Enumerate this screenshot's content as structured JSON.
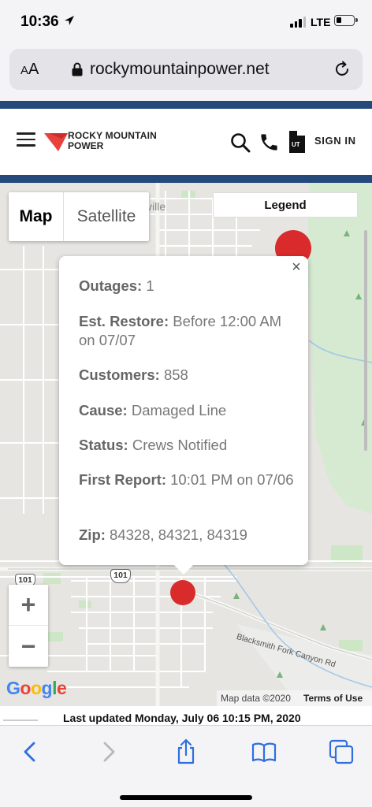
{
  "status_bar": {
    "time": "10:36",
    "network": "LTE",
    "icons": [
      "location-arrow-icon",
      "signal-icon",
      "battery-icon"
    ]
  },
  "browser": {
    "text_size_label_big": "A",
    "text_size_label_small": "A",
    "url": "rockymountainpower.net",
    "icons": [
      "lock-icon",
      "reload-icon"
    ]
  },
  "site_header": {
    "logo_line1": "ROCKY MOUNTAIN",
    "logo_line2": "POWER",
    "state_label": "UT",
    "sign_in_label": "SIGN IN",
    "icons": [
      "menu-icon",
      "search-icon",
      "phone-icon",
      "utah-state-icon"
    ],
    "brand_color": "#24497a",
    "logo_accent": "#e8423d"
  },
  "map": {
    "map_button": "Map",
    "satellite_button": "Satellite",
    "legend_button": "Legend",
    "village_label": "ville",
    "road_label": "Blacksmith Fork Canyon Rd",
    "shields": [
      "101",
      "101"
    ],
    "attribution": "Map data ©2020",
    "terms": "Terms of Use",
    "google_letters": [
      "G",
      "o",
      "o",
      "g",
      "l",
      "e"
    ],
    "google_colors": [
      "#4285f4",
      "#ea4335",
      "#fbbc05",
      "#4285f4",
      "#34a853",
      "#ea4335"
    ],
    "marker_color": "#d92b2b",
    "zoom_in_label": "+",
    "zoom_out_label": "−"
  },
  "outage_popup": {
    "close_label": "×",
    "rows": [
      {
        "label": "Outages:",
        "value": "1"
      },
      {
        "label": "Est. Restore:",
        "value": "Before 12:00 AM on 07/07"
      },
      {
        "label": "Customers:",
        "value": "858"
      },
      {
        "label": "Cause:",
        "value": "Damaged Line"
      },
      {
        "label": "Status:",
        "value": "Crews Notified"
      },
      {
        "label": "First Report:",
        "value": "10:01 PM on 07/06"
      },
      {
        "label": "Zip:",
        "value": "84328, 84321, 84319"
      }
    ]
  },
  "last_updated": "Last updated Monday, July 06 10:15 PM, 2020",
  "toolbar": {
    "icons": [
      "back-icon",
      "forward-icon",
      "share-icon",
      "bookmarks-icon",
      "tabs-icon"
    ],
    "accent": "#2f6fde"
  }
}
